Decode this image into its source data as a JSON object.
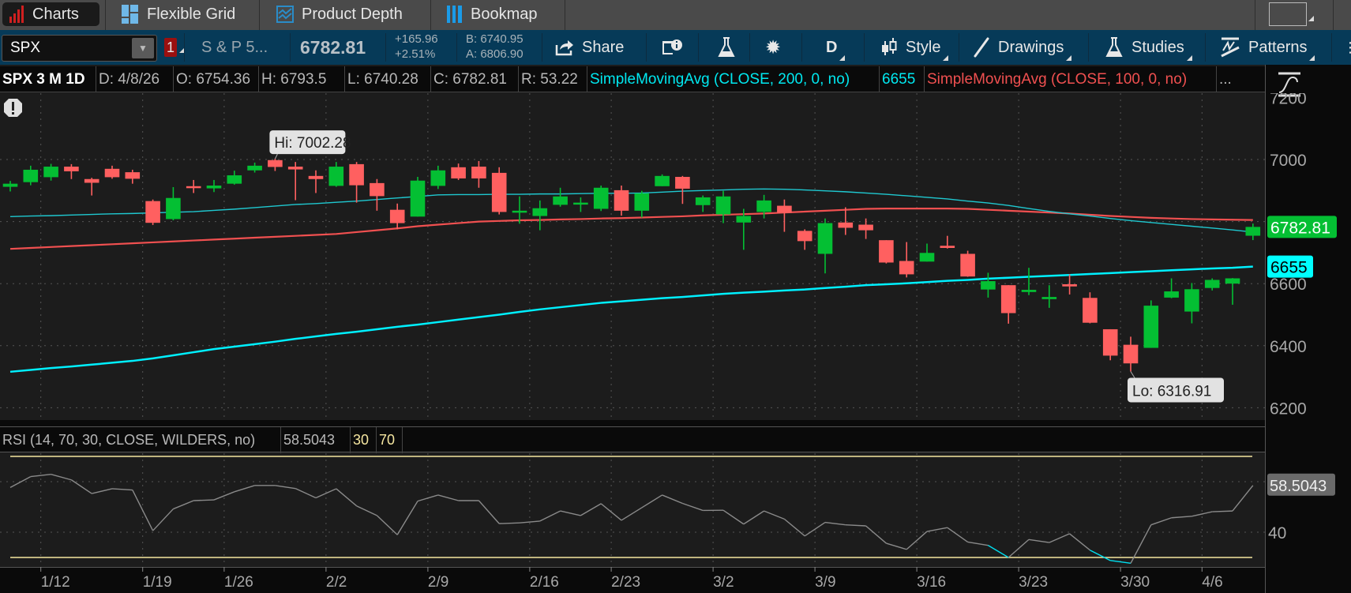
{
  "tabs": [
    {
      "label": "Charts",
      "icon": "bar-chart-icon",
      "active": true
    },
    {
      "label": "Flexible Grid",
      "icon": "grid-icon"
    },
    {
      "label": "Product Depth",
      "icon": "depth-chart-icon"
    },
    {
      "label": "Bookmap",
      "icon": "bookmap-icon"
    }
  ],
  "toolbar": {
    "symbol": "SPX",
    "link_badge": "1",
    "description": "S & P 5...",
    "last": "6782.81",
    "change": "+165.96",
    "change_pct": "+2.51%",
    "bid": "B: 6740.95",
    "ask": "A: 6806.90",
    "share": "Share",
    "aggregation": "D",
    "style": "Style",
    "drawings": "Drawings",
    "studies": "Studies",
    "patterns": "Patterns"
  },
  "info_row": {
    "title": "SPX 3 M 1D",
    "date": "D: 4/8/26",
    "open": "O: 6754.36",
    "high": "H: 6793.5",
    "low": "L: 6740.28",
    "close": "C: 6782.81",
    "range": "R: 53.22",
    "sma200_label": "SimpleMovingAvg (CLOSE, 200, 0, no)",
    "sma200_value": "6655",
    "sma100_label": "SimpleMovingAvg (CLOSE, 100, 0, no)",
    "more": "..."
  },
  "colors": {
    "up": "#04bf33",
    "down": "#ff6060",
    "sma200": "#00f0ff",
    "sma100": "#f05050",
    "third_ma": "#1fc8d0",
    "rsi": "#8a8a8a",
    "rsi_oversold": "#00e0f0",
    "rsi_levels": "#f5e6a0"
  },
  "chart_data": [
    {
      "type": "candlestick",
      "price_axis": {
        "ticks": [
          "7200",
          "7000",
          "6800",
          "6600",
          "6400",
          "6200"
        ],
        "range": [
          6160,
          7210
        ]
      },
      "date_ticks": [
        {
          "label": "1/12",
          "index": 2
        },
        {
          "label": "1/19",
          "index": 7
        },
        {
          "label": "1/26",
          "index": 11
        },
        {
          "label": "2/2",
          "index": 16
        },
        {
          "label": "2/9",
          "index": 21
        },
        {
          "label": "2/16",
          "index": 26
        },
        {
          "label": "2/23",
          "index": 30
        },
        {
          "label": "3/2",
          "index": 35
        },
        {
          "label": "3/9",
          "index": 40
        },
        {
          "label": "3/16",
          "index": 45
        },
        {
          "label": "3/23",
          "index": 50
        },
        {
          "label": "3/30",
          "index": 55
        },
        {
          "label": "4/6",
          "index": 59
        }
      ],
      "grid": true,
      "ohlc_columns": [
        "date",
        "open",
        "high",
        "low",
        "close"
      ],
      "ohlc": [
        [
          "1/8",
          6912,
          6931,
          6897,
          6922
        ],
        [
          "1/9",
          6927,
          6980,
          6917,
          6967
        ],
        [
          "1/12",
          6943,
          6986,
          6932,
          6977
        ],
        [
          "1/13",
          6977,
          6985,
          6937,
          6962
        ],
        [
          "1/14",
          6937,
          6941,
          6884,
          6925
        ],
        [
          "1/15",
          6970,
          6980,
          6938,
          6943
        ],
        [
          "1/16",
          6959,
          6967,
          6922,
          6938
        ],
        [
          "1/20",
          6866,
          6871,
          6789,
          6796
        ],
        [
          "1/21",
          6808,
          6911,
          6804,
          6876
        ],
        [
          "1/22",
          6914,
          6934,
          6892,
          6910
        ],
        [
          "1/23",
          6907,
          6934,
          6895,
          6916
        ],
        [
          "1/26",
          6922,
          6964,
          6919,
          6949
        ],
        [
          "1/27",
          6965,
          6990,
          6958,
          6980
        ],
        [
          "1/28",
          6998,
          7002.28,
          6963,
          6976
        ],
        [
          "1/29",
          6977,
          6992,
          6869,
          6968
        ],
        [
          "1/30",
          6947,
          6965,
          6892,
          6937
        ],
        [
          "2/2",
          6915,
          6992,
          6912,
          6977
        ],
        [
          "2/3",
          6985,
          6992,
          6861,
          6917
        ],
        [
          "2/4",
          6924,
          6937,
          6835,
          6882
        ],
        [
          "2/5",
          6838,
          6858,
          6775,
          6795
        ],
        [
          "2/6",
          6816,
          6944,
          6816,
          6932
        ],
        [
          "2/9",
          6915,
          6980,
          6905,
          6965
        ],
        [
          "2/10",
          6975,
          6987,
          6934,
          6939
        ],
        [
          "2/11",
          6977,
          6995,
          6909,
          6939
        ],
        [
          "2/12",
          6957,
          6975,
          6823,
          6831
        ],
        [
          "2/13",
          6831,
          6881,
          6793,
          6835
        ],
        [
          "2/17",
          6818,
          6868,
          6772,
          6843
        ],
        [
          "2/18",
          6854,
          6909,
          6848,
          6881
        ],
        [
          "2/19",
          6857,
          6878,
          6831,
          6861
        ],
        [
          "2/20",
          6841,
          6916,
          6834,
          6909
        ],
        [
          "2/23",
          6901,
          6916,
          6819,
          6835
        ],
        [
          "2/24",
          6835,
          6899,
          6813,
          6891
        ],
        [
          "2/25",
          6914,
          6952,
          6914,
          6947
        ],
        [
          "2/26",
          6944,
          6947,
          6857,
          6906
        ],
        [
          "2/27",
          6853,
          6884,
          6831,
          6878
        ],
        [
          "3/2",
          6823,
          6899,
          6795,
          6881
        ],
        [
          "3/3",
          6797,
          6841,
          6709,
          6818
        ],
        [
          "3/4",
          6831,
          6886,
          6810,
          6868
        ],
        [
          "3/5",
          6851,
          6871,
          6767,
          6828
        ],
        [
          "3/6",
          6770,
          6775,
          6709,
          6737
        ],
        [
          "3/9",
          6696,
          6810,
          6633,
          6795
        ],
        [
          "3/10",
          6797,
          6846,
          6757,
          6780
        ],
        [
          "3/11",
          6790,
          6810,
          6744,
          6772
        ],
        [
          "3/12",
          6740,
          6740,
          6665,
          6668
        ],
        [
          "3/13",
          6673,
          6734,
          6620,
          6630
        ],
        [
          "3/16",
          6671,
          6729,
          6671,
          6699
        ],
        [
          "3/17",
          6722,
          6754,
          6713,
          6715
        ],
        [
          "3/18",
          6696,
          6706,
          6622,
          6623
        ],
        [
          "3/19",
          6581,
          6635,
          6555,
          6608
        ],
        [
          "3/20",
          6595,
          6595,
          6471,
          6505
        ],
        [
          "3/23",
          6573,
          6651,
          6563,
          6580
        ],
        [
          "3/24",
          6550,
          6595,
          6522,
          6557
        ],
        [
          "3/25",
          6598,
          6630,
          6565,
          6591
        ],
        [
          "3/26",
          6554,
          6572,
          6472,
          6474
        ],
        [
          "3/27",
          6453,
          6453,
          6353,
          6368
        ],
        [
          "3/30",
          6403,
          6429,
          6316.91,
          6343
        ],
        [
          "3/31",
          6393,
          6546,
          6393,
          6529
        ],
        [
          "4/1",
          6555,
          6617,
          6553,
          6575
        ],
        [
          "4/2",
          6510,
          6602,
          6472,
          6582
        ],
        [
          "4/6",
          6586,
          6617,
          6578,
          6612
        ],
        [
          "4/7",
          6600,
          6618,
          6532,
          6617
        ],
        [
          "4/8",
          6754.36,
          6793.5,
          6740.28,
          6782.81
        ]
      ],
      "series": [
        {
          "name": "SimpleMovingAvg (CLOSE, 200, 0, no)",
          "color": "#00f0ff",
          "values": [
            6316,
            6322,
            6328,
            6333,
            6339,
            6345,
            6351,
            6359,
            6369,
            6379,
            6389,
            6397,
            6405,
            6413,
            6422,
            6430,
            6438,
            6445,
            6453,
            6461,
            6468,
            6476,
            6484,
            6492,
            6500,
            6509,
            6517,
            6524,
            6531,
            6538,
            6543,
            6548,
            6553,
            6557,
            6562,
            6567,
            6571,
            6574,
            6578,
            6581,
            6586,
            6590,
            6595,
            6598,
            6601,
            6605,
            6609,
            6612,
            6616,
            6619,
            6622,
            6625,
            6628,
            6631,
            6634,
            6637,
            6640,
            6643,
            6646,
            6649,
            6651,
            6655
          ]
        },
        {
          "name": "SimpleMovingAvg (CLOSE, 100, 0, no)",
          "color": "#f05050",
          "values": [
            6712,
            6715,
            6718,
            6721,
            6724,
            6727,
            6730,
            6733,
            6736,
            6739,
            6742,
            6745,
            6748,
            6751,
            6754,
            6757,
            6760,
            6766,
            6772,
            6778,
            6785,
            6790,
            6795,
            6800,
            6802,
            6804,
            6805,
            6807,
            6808,
            6810,
            6811,
            6813,
            6815,
            6817,
            6820,
            6822,
            6824,
            6826,
            6829,
            6832,
            6835,
            6838,
            6841,
            6842,
            6842,
            6842,
            6842,
            6841,
            6838,
            6835,
            6832,
            6829,
            6826,
            6822,
            6818,
            6815,
            6812,
            6810,
            6808,
            6807,
            6806,
            6805
          ]
        },
        {
          "color": "#1fc8d0",
          "values": [
            6816,
            6818,
            6819,
            6821,
            6823,
            6825,
            6826,
            6828,
            6830,
            6832,
            6836,
            6840,
            6845,
            6850,
            6855,
            6858,
            6862,
            6866,
            6871,
            6876,
            6881,
            6886,
            6887,
            6887,
            6888,
            6888,
            6889,
            6889,
            6890,
            6891,
            6891,
            6892,
            6895,
            6898,
            6900,
            6902,
            6904,
            6905,
            6904,
            6902,
            6899,
            6896,
            6892,
            6888,
            6883,
            6878,
            6873,
            6866,
            6860,
            6852,
            6842,
            6833,
            6825,
            6818,
            6810,
            6803,
            6797,
            6791,
            6785,
            6779,
            6773,
            6766
          ]
        }
      ],
      "annotations": {
        "high_label": "Hi: 7002.28",
        "high_index": 13,
        "high_value": 7002.28,
        "low_label": "Lo: 6316.91",
        "low_index": 55,
        "low_value": 6316.91
      },
      "axis_badges": [
        {
          "text": "6782.81",
          "value": 6782.81,
          "color": "#04bf33"
        },
        {
          "text": "6655",
          "value": 6655,
          "color": "#00ffff"
        }
      ]
    },
    {
      "type": "line",
      "title": "RSI (14, 70, 30, CLOSE, WILDERS, no)",
      "current": "58.5043",
      "oversold": "30",
      "overbought": "70",
      "y_ticks": [
        "40"
      ],
      "range": [
        30,
        70
      ],
      "values": [
        57.7,
        62.0,
        62.9,
        60.7,
        55.3,
        57.2,
        56.7,
        40.6,
        49.2,
        52.5,
        52.8,
        56.0,
        58.5,
        58.5,
        57.3,
        53.6,
        57.2,
        50.4,
        46.6,
        39.0,
        52.3,
        54.7,
        52.5,
        52.5,
        43.4,
        43.7,
        44.4,
        48.4,
        46.6,
        51.3,
        44.7,
        49.7,
        54.7,
        51.4,
        48.6,
        48.7,
        43.2,
        48.4,
        45.2,
        38.5,
        43.9,
        42.9,
        42.5,
        35.6,
        33.2,
        40.3,
        41.8,
        36.1,
        34.8,
        30.0,
        37.1,
        35.9,
        39.4,
        32.9,
        28.8,
        27.7,
        42.9,
        45.7,
        46.3,
        48.1,
        48.4,
        58.5043
      ]
    }
  ]
}
